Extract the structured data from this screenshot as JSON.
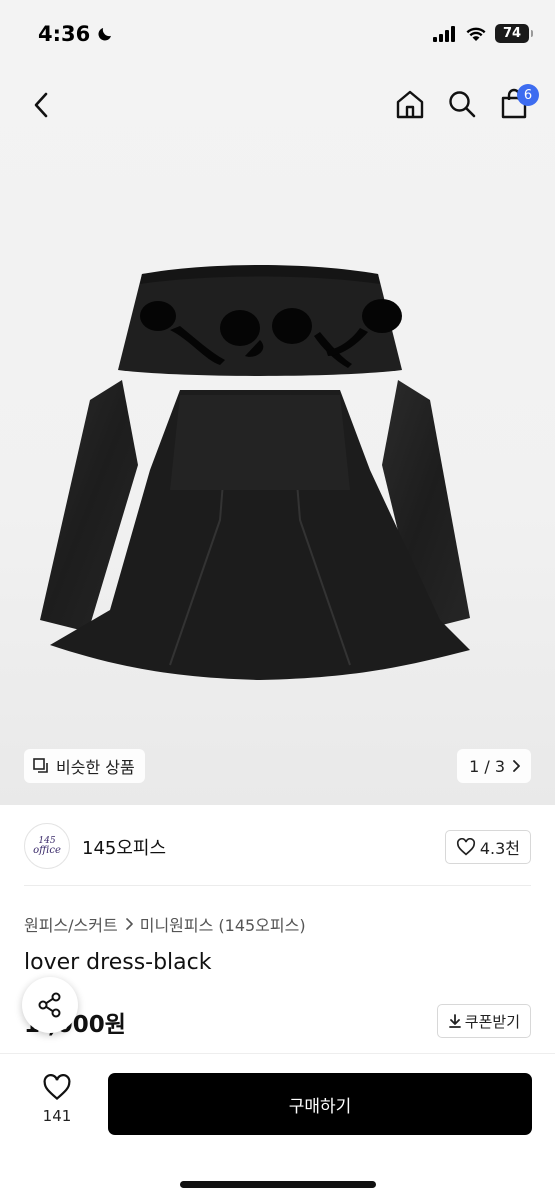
{
  "status_bar": {
    "time": "4:36",
    "battery": "74"
  },
  "nav": {
    "back_icon": "chevron-left-icon",
    "icons": [
      "home-icon",
      "search-icon",
      "cart-icon"
    ],
    "cart_count": "6"
  },
  "gallery": {
    "similar_label": "비슷한 상품",
    "pager": "1 / 3"
  },
  "shop": {
    "logo_line1": "145",
    "logo_line2": "office",
    "name": "145오피스",
    "likes": "4.3천"
  },
  "product": {
    "breadcrumb_1": "원피스/스커트",
    "breadcrumb_2": "미니원피스 (145오피스)",
    "title": "lover dress-black",
    "price": "1 ,000원",
    "coupon_label": "쿠폰받기"
  },
  "bottom": {
    "wish_count": "141",
    "buy_label": "구매하기"
  },
  "colors": {
    "accent": "#3d6cf0",
    "buy_button": "#000000",
    "background": "#f3f3f3"
  }
}
